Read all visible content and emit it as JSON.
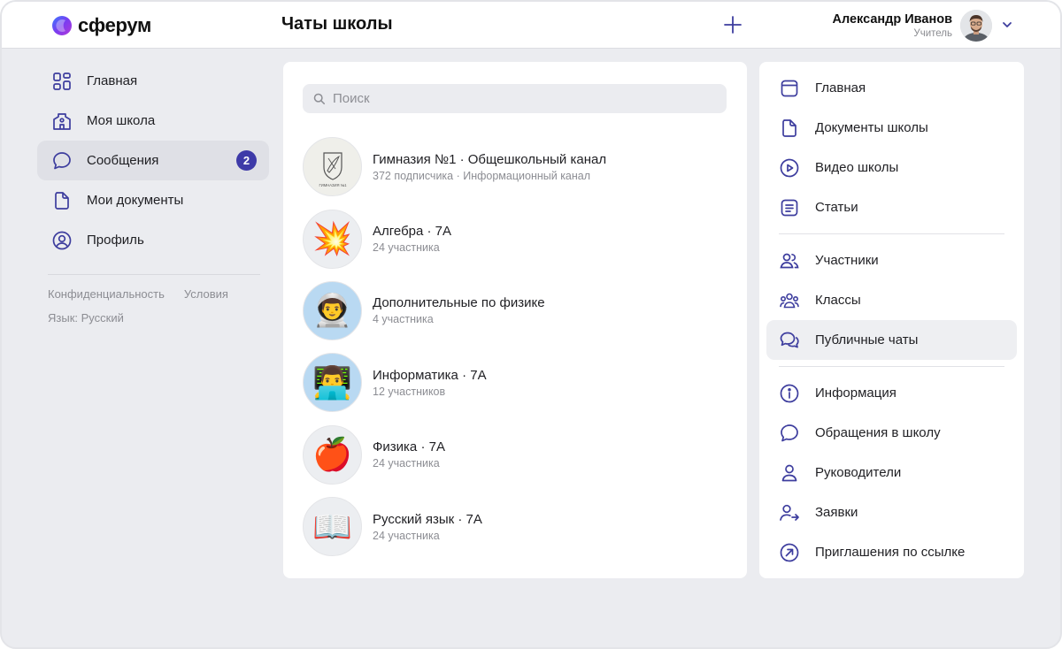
{
  "header": {
    "logo_text": "сферум",
    "page_title": "Чаты школы",
    "add_icon": "plus-icon",
    "user_name": "Александр Иванов",
    "user_role": "Учитель",
    "menu_icon": "chevron-down-icon"
  },
  "colors": {
    "accent": "#3e3aa8",
    "icon_stroke": "#3d3d9e",
    "background": "#ebecf0"
  },
  "leftnav": {
    "items": [
      {
        "label": "Главная",
        "icon": "grid-icon"
      },
      {
        "label": "Моя школа",
        "icon": "school-icon"
      },
      {
        "label": "Сообщения",
        "icon": "message-icon",
        "badge": "2",
        "active": true
      },
      {
        "label": "Мои документы",
        "icon": "document-icon"
      },
      {
        "label": "Профиль",
        "icon": "profile-icon"
      }
    ],
    "footer": {
      "privacy": "Конфиденциальность",
      "terms": "Условия",
      "language": "Язык: Русский"
    }
  },
  "search": {
    "placeholder": "Поиск"
  },
  "chats": [
    {
      "name": "Гимназия №1 · Общешкольный канал",
      "subtitle": "372 подписчика · Информационный канал",
      "avatar": "school-emblem"
    },
    {
      "name": "Алгебра · 7А",
      "subtitle": "24 участника",
      "avatar": "💥"
    },
    {
      "name": "Дополнительные по физике",
      "subtitle": "4 участника",
      "avatar": "👨‍🚀"
    },
    {
      "name": "Информатика · 7А",
      "subtitle": "12 участников",
      "avatar": "👨‍💻"
    },
    {
      "name": "Физика · 7А",
      "subtitle": "24 участника",
      "avatar": "🍎"
    },
    {
      "name": "Русский язык · 7А",
      "subtitle": "24 участника",
      "avatar": "📖"
    }
  ],
  "emblem_text": "ГИМНАЗИЯ №1",
  "rightnav": {
    "groups": [
      [
        {
          "label": "Главная",
          "icon": "home-panel-icon"
        },
        {
          "label": "Документы школы",
          "icon": "document-icon"
        },
        {
          "label": "Видео школы",
          "icon": "play-icon"
        },
        {
          "label": "Статьи",
          "icon": "article-icon"
        }
      ],
      [
        {
          "label": "Участники",
          "icon": "users-icon"
        },
        {
          "label": "Классы",
          "icon": "group-icon"
        },
        {
          "label": "Публичные чаты",
          "icon": "chats-icon",
          "active": true
        }
      ],
      [
        {
          "label": "Информация",
          "icon": "info-icon"
        },
        {
          "label": "Обращения в школу",
          "icon": "message-icon"
        },
        {
          "label": "Руководители",
          "icon": "person-icon"
        },
        {
          "label": "Заявки",
          "icon": "user-arrow-icon"
        },
        {
          "label": "Приглашения по ссылке",
          "icon": "link-arrow-icon"
        }
      ]
    ]
  }
}
